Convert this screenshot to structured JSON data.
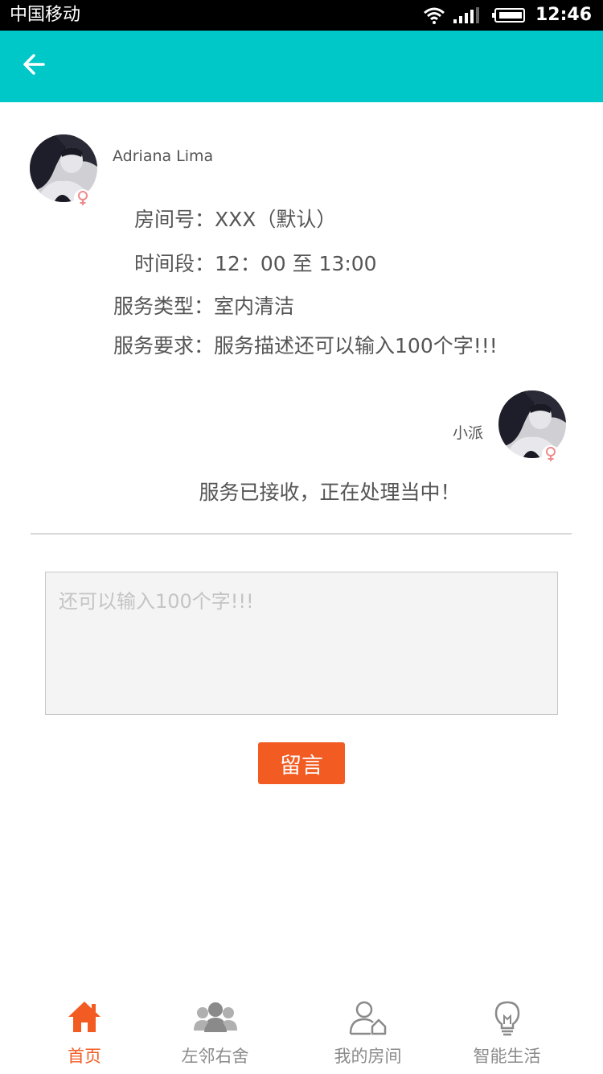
{
  "status_bar": {
    "carrier": "中国移动",
    "time": "12:46"
  },
  "header": {
    "back_icon": "arrow-left-icon"
  },
  "request": {
    "user_name": "Adriana Lima",
    "room_label": "房间号：",
    "room_value": "XXX（默认）",
    "time_label": "时间段：",
    "time_value": "12：00 至 13:00",
    "type_label": "服务类型：",
    "type_value": "室内清洁",
    "requirement_label": "服务要求：",
    "requirement_value": "服务描述还可以输入100个字!!!"
  },
  "reply": {
    "agent_name": "小派",
    "message": "服务已接收，正在处理当中！"
  },
  "compose": {
    "placeholder": "还可以输入100个字!!!",
    "submit_label": "留言"
  },
  "tabbar": {
    "tabs": [
      {
        "label": "首页",
        "icon": "home-icon",
        "active": true
      },
      {
        "label": "左邻右舍",
        "icon": "neighbors-icon",
        "active": false
      },
      {
        "label": "我的房间",
        "icon": "my-room-icon",
        "active": false
      },
      {
        "label": "智能生活",
        "icon": "bulb-icon",
        "active": false
      }
    ]
  },
  "colors": {
    "header_bg": "#00c8c8",
    "accent_orange": "#f25b22",
    "female_pink": "#f08a8a"
  }
}
